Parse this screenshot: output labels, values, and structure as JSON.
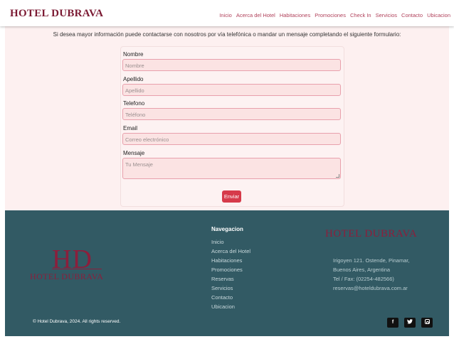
{
  "navbar": {
    "brand": "HOTEL DUBRAVA",
    "links": [
      "Inicio",
      "Acerca del Hotel",
      "Habitaciones",
      "Promociones",
      "Check In",
      "Servicios",
      "Contacto",
      "Ubicacion"
    ]
  },
  "main": {
    "intro": "Si desea mayor información puede contactarse con nosotros por vía telefónica o mandar un mensaje completando el siguiente formulario:",
    "form": {
      "fields": [
        {
          "label": "Nombre",
          "placeholder": "Nombre"
        },
        {
          "label": "Apellido",
          "placeholder": "Apellido"
        },
        {
          "label": "Telefono",
          "placeholder": "Teléfono"
        },
        {
          "label": "Email",
          "placeholder": "Correo electrónico"
        },
        {
          "label": "Mensaje",
          "placeholder": "Tu Mensaje"
        }
      ],
      "submit": "Enviar"
    }
  },
  "footer": {
    "logo_mark": "HD",
    "logo_text": "HOTEL DUBRAVA",
    "nav_title": "Navegacion",
    "nav_items": [
      "Inicio",
      "Acerca del Hotel",
      "Habitaciones",
      "Promociones",
      "Reservas",
      "Servicios",
      "Contacto",
      "Ubicacion"
    ],
    "brand": "HOTEL DUBRAVA",
    "contact": [
      "Irigoyen 121. Ostende, Pinamar,",
      "Buenos Aires, Argentina",
      "Tel / Fax: (02254-482566)",
      "reservas@hoteldubrava.com.ar"
    ],
    "copyright": "© Hotel Dubrava, 2024. All rights reserved.",
    "social": {
      "facebook": "f",
      "twitter_icon": "twitter-bird"
    }
  },
  "colors": {
    "brand": "#7b1a33",
    "nav_link": "#b0405a",
    "page_bg": "#fdf0f0",
    "field_bg": "#fbe3e3",
    "button": "#d63a4a",
    "footer_bg": "#325a64"
  }
}
